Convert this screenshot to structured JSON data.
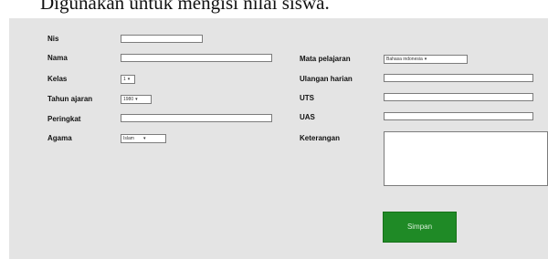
{
  "caption": "Digunakan untuk mengisi nilai siswa.",
  "form": {
    "left": {
      "nis": {
        "label": "Nis",
        "value": ""
      },
      "nama": {
        "label": "Nama",
        "value": ""
      },
      "kelas": {
        "label": "Kelas",
        "selected": "1"
      },
      "tahun_ajaran": {
        "label": "Tahun ajaran",
        "selected": "1980"
      },
      "peringkat": {
        "label": "Peringkat",
        "value": ""
      },
      "agama": {
        "label": "Agama",
        "selected": "Islam"
      }
    },
    "right": {
      "mata_pelajaran": {
        "label": "Mata pelajaran",
        "selected": "Bahasa indonesia"
      },
      "ulangan_harian": {
        "label": "Ulangan harian",
        "value": ""
      },
      "uts": {
        "label": "UTS",
        "value": ""
      },
      "uas": {
        "label": "UAS",
        "value": ""
      },
      "keterangan": {
        "label": "Keterangan",
        "value": ""
      }
    },
    "submit_label": "Simpan"
  },
  "icons": {
    "dropdown_arrow": "chevron-down-icon"
  }
}
